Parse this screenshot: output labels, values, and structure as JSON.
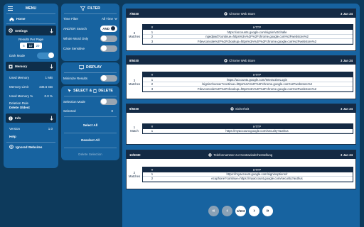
{
  "menu": {
    "title": "MENU",
    "home": "Home",
    "settings": "Settings",
    "results_per_page_label": "Results Per Page",
    "results_per_page_options": [
      "5",
      "10",
      "20"
    ],
    "results_per_page_selected": "10",
    "dark_mode_label": "Dark Mode",
    "memory_title": "Memory",
    "used_memory_label": "Used Memory",
    "used_memory_value": "1 MB",
    "memory_limit_label": "Memory Limit",
    "memory_limit_value": "436.6 GB",
    "used_memory_pct_label": "Used Memory %",
    "used_memory_pct_value": "0.0 %",
    "deletion_rule_label": "Deletion Rule",
    "deletion_rule_value": "Delete Oldest",
    "info_title": "Info",
    "version_label": "Version",
    "version_value": "1.0",
    "help_label": "Help",
    "ignored_websites": "Ignored Websites"
  },
  "filter": {
    "title": "FILTER",
    "time_filter_label": "Time Filter",
    "time_filter_value": "All Time",
    "andor_label": "AND/OR Search",
    "andor_value": "AND",
    "whole_word_label": "Whole Word Only",
    "case_sensitive_label": "Case Sensitive"
  },
  "display": {
    "title": "DISPLAY",
    "minimize_label": "Minimize Results"
  },
  "select": {
    "select_label": "SELECT",
    "amp": "&",
    "delete_label": "DELETE",
    "selection_mode_label": "Selection Mode",
    "selected_label": "Selected",
    "selected_value": "0",
    "select_all": "Select All",
    "deselect_all": "Deselect All",
    "delete_selection": "Delete Selection"
  },
  "results": [
    {
      "index": "7/5030",
      "site": "Chrome Web Store",
      "date": "3 Jan 24",
      "matches": "3",
      "matches_label": "Matches",
      "col_num": "#",
      "col_http": "HTTP",
      "rows": [
        {
          "n": "1",
          "url": "https://accounts.google.com/signin/v2/challe"
        },
        {
          "n": "2",
          "url": "ngedpwd?continue=https%3A%2F%2Fchrome.google.com%2Fwebstore%2"
        },
        {
          "n": "3",
          "url": "Fdevconsole%2F%2Fcbookup=https%3A%2F%2Fchrome.google.com%2Fwebstore%2"
        }
      ]
    },
    {
      "index": "8/5030",
      "site": "Chrome Web Store",
      "date": "3 Jan 24",
      "matches": "3",
      "matches_label": "Matches",
      "col_num": "#",
      "col_http": "HTTP",
      "rows": [
        {
          "n": "1",
          "url": "https://accounts.google.com/InteractiveLogin"
        },
        {
          "n": "2",
          "url": "/signinchooser?continue=https%3A%2F%2Fchrome.google.com%2Fwebstore%2"
        },
        {
          "n": "3",
          "url": "Fdevconsole%2F%2Fcbookup=https%3A%2F%2Fchrome.google.com%2Fwebstore%2"
        }
      ]
    },
    {
      "index": "9/5030",
      "site": "Sicherheit",
      "date": "3 Jan 24",
      "matches": "1",
      "matches_label": "Match",
      "col_num": "#",
      "col_http": "HTTP",
      "rows": [
        {
          "n": "1",
          "url": "https://myaccount.google.com/security?authus"
        }
      ]
    },
    {
      "index": "10/5030",
      "site": "Telefonnummer zur Kontowiederherstellung",
      "date": "3 Jan 24",
      "matches": "2",
      "matches_label": "Matches",
      "col_num": "#",
      "col_http": "HTTP",
      "rows": [
        {
          "n": "1",
          "url": "https://myaccount.google.com/signinoptions/r"
        },
        {
          "n": "2",
          "url": "ecuphone?continue=https://myaccount.google.com/security?authus"
        }
      ]
    }
  ],
  "pagination": {
    "first": "«",
    "prev": "‹",
    "current": "1/503",
    "next": "›",
    "last": "»"
  },
  "colors": {
    "background": "#0d3a5c",
    "panel": "#1763a0",
    "card_header": "#142a44",
    "accent": "#3c8ac4"
  }
}
